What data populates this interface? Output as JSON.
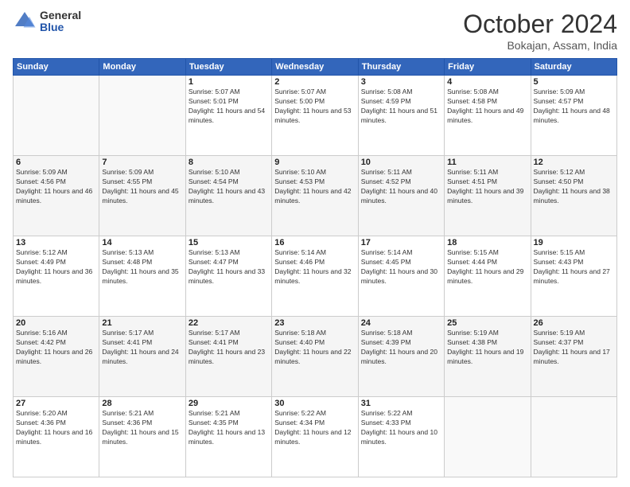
{
  "logo": {
    "general": "General",
    "blue": "Blue"
  },
  "title": "October 2024",
  "location": "Bokajan, Assam, India",
  "days_header": [
    "Sunday",
    "Monday",
    "Tuesday",
    "Wednesday",
    "Thursday",
    "Friday",
    "Saturday"
  ],
  "weeks": [
    [
      {
        "day": "",
        "info": ""
      },
      {
        "day": "",
        "info": ""
      },
      {
        "day": "1",
        "sunrise": "5:07 AM",
        "sunset": "5:01 PM",
        "daylight": "11 hours and 54 minutes."
      },
      {
        "day": "2",
        "sunrise": "5:07 AM",
        "sunset": "5:00 PM",
        "daylight": "11 hours and 53 minutes."
      },
      {
        "day": "3",
        "sunrise": "5:08 AM",
        "sunset": "4:59 PM",
        "daylight": "11 hours and 51 minutes."
      },
      {
        "day": "4",
        "sunrise": "5:08 AM",
        "sunset": "4:58 PM",
        "daylight": "11 hours and 49 minutes."
      },
      {
        "day": "5",
        "sunrise": "5:09 AM",
        "sunset": "4:57 PM",
        "daylight": "11 hours and 48 minutes."
      }
    ],
    [
      {
        "day": "6",
        "sunrise": "5:09 AM",
        "sunset": "4:56 PM",
        "daylight": "11 hours and 46 minutes."
      },
      {
        "day": "7",
        "sunrise": "5:09 AM",
        "sunset": "4:55 PM",
        "daylight": "11 hours and 45 minutes."
      },
      {
        "day": "8",
        "sunrise": "5:10 AM",
        "sunset": "4:54 PM",
        "daylight": "11 hours and 43 minutes."
      },
      {
        "day": "9",
        "sunrise": "5:10 AM",
        "sunset": "4:53 PM",
        "daylight": "11 hours and 42 minutes."
      },
      {
        "day": "10",
        "sunrise": "5:11 AM",
        "sunset": "4:52 PM",
        "daylight": "11 hours and 40 minutes."
      },
      {
        "day": "11",
        "sunrise": "5:11 AM",
        "sunset": "4:51 PM",
        "daylight": "11 hours and 39 minutes."
      },
      {
        "day": "12",
        "sunrise": "5:12 AM",
        "sunset": "4:50 PM",
        "daylight": "11 hours and 38 minutes."
      }
    ],
    [
      {
        "day": "13",
        "sunrise": "5:12 AM",
        "sunset": "4:49 PM",
        "daylight": "11 hours and 36 minutes."
      },
      {
        "day": "14",
        "sunrise": "5:13 AM",
        "sunset": "4:48 PM",
        "daylight": "11 hours and 35 minutes."
      },
      {
        "day": "15",
        "sunrise": "5:13 AM",
        "sunset": "4:47 PM",
        "daylight": "11 hours and 33 minutes."
      },
      {
        "day": "16",
        "sunrise": "5:14 AM",
        "sunset": "4:46 PM",
        "daylight": "11 hours and 32 minutes."
      },
      {
        "day": "17",
        "sunrise": "5:14 AM",
        "sunset": "4:45 PM",
        "daylight": "11 hours and 30 minutes."
      },
      {
        "day": "18",
        "sunrise": "5:15 AM",
        "sunset": "4:44 PM",
        "daylight": "11 hours and 29 minutes."
      },
      {
        "day": "19",
        "sunrise": "5:15 AM",
        "sunset": "4:43 PM",
        "daylight": "11 hours and 27 minutes."
      }
    ],
    [
      {
        "day": "20",
        "sunrise": "5:16 AM",
        "sunset": "4:42 PM",
        "daylight": "11 hours and 26 minutes."
      },
      {
        "day": "21",
        "sunrise": "5:17 AM",
        "sunset": "4:41 PM",
        "daylight": "11 hours and 24 minutes."
      },
      {
        "day": "22",
        "sunrise": "5:17 AM",
        "sunset": "4:41 PM",
        "daylight": "11 hours and 23 minutes."
      },
      {
        "day": "23",
        "sunrise": "5:18 AM",
        "sunset": "4:40 PM",
        "daylight": "11 hours and 22 minutes."
      },
      {
        "day": "24",
        "sunrise": "5:18 AM",
        "sunset": "4:39 PM",
        "daylight": "11 hours and 20 minutes."
      },
      {
        "day": "25",
        "sunrise": "5:19 AM",
        "sunset": "4:38 PM",
        "daylight": "11 hours and 19 minutes."
      },
      {
        "day": "26",
        "sunrise": "5:19 AM",
        "sunset": "4:37 PM",
        "daylight": "11 hours and 17 minutes."
      }
    ],
    [
      {
        "day": "27",
        "sunrise": "5:20 AM",
        "sunset": "4:36 PM",
        "daylight": "11 hours and 16 minutes."
      },
      {
        "day": "28",
        "sunrise": "5:21 AM",
        "sunset": "4:36 PM",
        "daylight": "11 hours and 15 minutes."
      },
      {
        "day": "29",
        "sunrise": "5:21 AM",
        "sunset": "4:35 PM",
        "daylight": "11 hours and 13 minutes."
      },
      {
        "day": "30",
        "sunrise": "5:22 AM",
        "sunset": "4:34 PM",
        "daylight": "11 hours and 12 minutes."
      },
      {
        "day": "31",
        "sunrise": "5:22 AM",
        "sunset": "4:33 PM",
        "daylight": "11 hours and 10 minutes."
      },
      {
        "day": "",
        "info": ""
      },
      {
        "day": "",
        "info": ""
      }
    ]
  ]
}
